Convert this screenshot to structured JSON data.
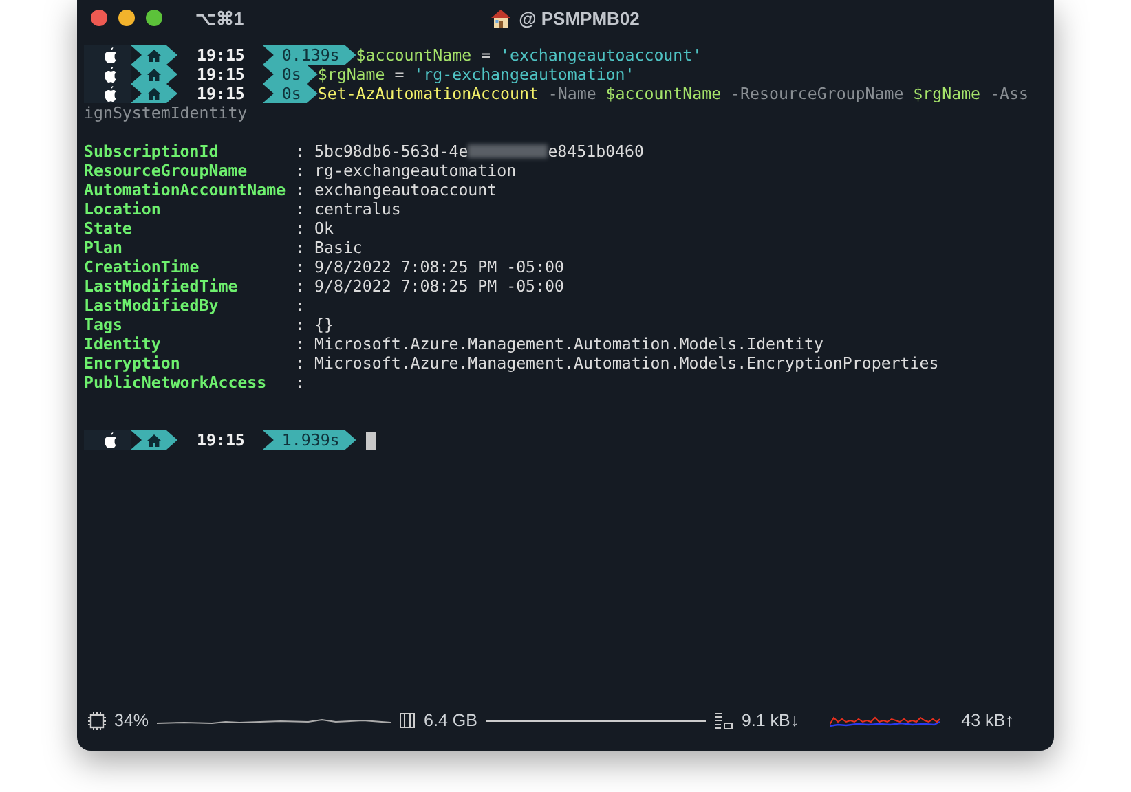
{
  "window": {
    "shortcut": "⌥⌘1",
    "title": "@ PSMPMB02"
  },
  "history": [
    {
      "time": "19:15",
      "duration": "0.139s",
      "tokens": [
        {
          "kind": "variable",
          "text": "$accountName"
        },
        {
          "kind": "operator",
          "text": "="
        },
        {
          "kind": "string",
          "text": "'exchangeautoaccount'"
        }
      ]
    },
    {
      "time": "19:15",
      "duration": "0s",
      "tokens": [
        {
          "kind": "variable",
          "text": "$rgName"
        },
        {
          "kind": "operator",
          "text": "="
        },
        {
          "kind": "string",
          "text": "'rg-exchangeautomation'"
        }
      ]
    },
    {
      "time": "19:15",
      "duration": "0s",
      "tokens": [
        {
          "kind": "command",
          "text": "Set-AzAutomationAccount"
        },
        {
          "kind": "parameter",
          "text": "-Name"
        },
        {
          "kind": "variable",
          "text": "$accountName"
        },
        {
          "kind": "parameter",
          "text": "-ResourceGroupName"
        },
        {
          "kind": "variable",
          "text": "$rgName"
        },
        {
          "kind": "parameter",
          "text": "-Ass"
        }
      ],
      "wrapped": "ignSystemIdentity"
    }
  ],
  "output": [
    {
      "name": "SubscriptionId",
      "separator": ":",
      "value": "5bc98db6-563d-4e",
      "value_tail": "e8451b0460"
    },
    {
      "name": "ResourceGroupName",
      "separator": ":",
      "value": "rg-exchangeautomation"
    },
    {
      "name": "AutomationAccountName",
      "separator": ":",
      "value": "exchangeautoaccount"
    },
    {
      "name": "Location",
      "separator": ":",
      "value": "centralus"
    },
    {
      "name": "State",
      "separator": ":",
      "value": "Ok"
    },
    {
      "name": "Plan",
      "separator": ":",
      "value": "Basic"
    },
    {
      "name": "CreationTime",
      "separator": ":",
      "value": "9/8/2022 7:08:25 PM -05:00"
    },
    {
      "name": "LastModifiedTime",
      "separator": ":",
      "value": "9/8/2022 7:08:25 PM -05:00"
    },
    {
      "name": "LastModifiedBy",
      "separator": ":"
    },
    {
      "name": "Tags",
      "separator": ":",
      "value": "{}"
    },
    {
      "name": "Identity",
      "separator": ":",
      "value": "Microsoft.Azure.Management.Automation.Models.Identity"
    },
    {
      "name": "Encryption",
      "separator": ":",
      "value": "Microsoft.Azure.Management.Automation.Models.EncryptionProperties"
    },
    {
      "name": "PublicNetworkAccess",
      "separator": ":"
    }
  ],
  "prompt": {
    "time": "19:15",
    "duration": "1.939s"
  },
  "status_bar": {
    "cpu": "34%",
    "memory": "6.4 GB",
    "download": "9.1 kB↓",
    "upload": "43 kB↑"
  }
}
